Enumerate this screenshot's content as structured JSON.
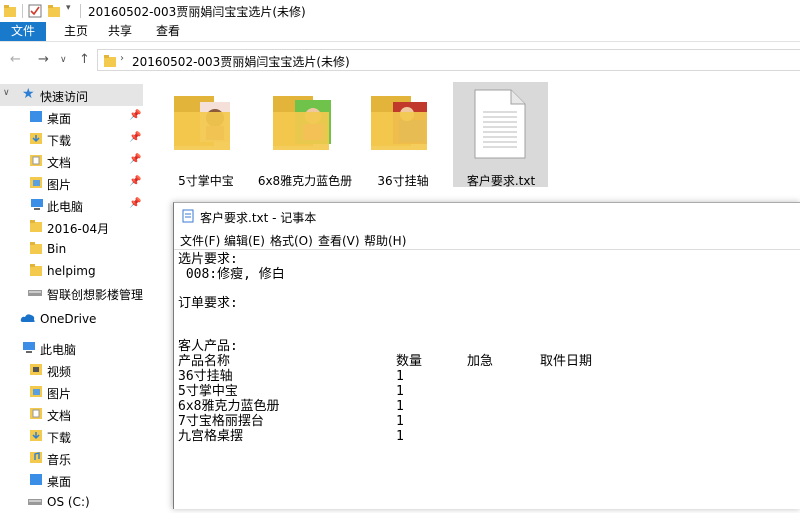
{
  "window": {
    "title": "20160502-003贾丽娟闫宝宝选片(未修)"
  },
  "ribbon": {
    "tabs": [
      "文件",
      "主页",
      "共享",
      "查看"
    ]
  },
  "address": {
    "path": "20160502-003贾丽娟闫宝宝选片(未修)"
  },
  "sidebar": {
    "quick_access": "快速访问",
    "items": [
      {
        "label": "桌面",
        "icon": "desktop-folder-icon",
        "pinned": true
      },
      {
        "label": "下载",
        "icon": "download-folder-icon",
        "pinned": true
      },
      {
        "label": "文档",
        "icon": "documents-folder-icon",
        "pinned": true
      },
      {
        "label": "图片",
        "icon": "pictures-folder-icon",
        "pinned": true
      },
      {
        "label": "此电脑",
        "icon": "computer-icon",
        "pinned": true
      },
      {
        "label": "2016-04月",
        "icon": "folder-icon",
        "pinned": false
      },
      {
        "label": "Bin",
        "icon": "folder-icon",
        "pinned": false
      },
      {
        "label": "helpimg",
        "icon": "folder-icon",
        "pinned": false
      },
      {
        "label": "智联创想影楼管理软",
        "icon": "drive-icon",
        "pinned": false
      }
    ],
    "onedrive": "OneDrive",
    "this_pc": "此电脑",
    "pc_items": [
      {
        "label": "视频",
        "icon": "videos-folder-icon"
      },
      {
        "label": "图片",
        "icon": "pictures-folder-icon"
      },
      {
        "label": "文档",
        "icon": "documents-folder-icon"
      },
      {
        "label": "下载",
        "icon": "download-folder-icon"
      },
      {
        "label": "音乐",
        "icon": "music-folder-icon"
      },
      {
        "label": "桌面",
        "icon": "desktop-folder-icon"
      },
      {
        "label": "OS (C:)",
        "icon": "drive-icon"
      }
    ]
  },
  "files": [
    {
      "name": "5寸掌中宝",
      "type": "folder"
    },
    {
      "name": "6x8雅克力蓝色册",
      "type": "folder"
    },
    {
      "name": "36寸挂轴",
      "type": "folder"
    },
    {
      "name": "客户要求.txt",
      "type": "text"
    }
  ],
  "notepad": {
    "title": "客户要求.txt - 记事本",
    "menu": [
      "文件(F)",
      "编辑(E)",
      "格式(O)",
      "查看(V)",
      "帮助(H)"
    ],
    "lines": {
      "l1": "选片要求:",
      "l2": " 008:修瘦, 修白",
      "l3": "订单要求:",
      "l4": "客人产品:"
    },
    "table": {
      "headers": [
        "产品名称",
        "数量",
        "加急",
        "取件日期"
      ],
      "rows": [
        [
          "36寸挂轴",
          "1"
        ],
        [
          "5寸掌中宝",
          "1"
        ],
        [
          "6x8雅克力蓝色册",
          "1"
        ],
        [
          "7寸宝格丽摆台",
          "1"
        ],
        [
          "九宫格桌摆",
          "1"
        ]
      ]
    }
  },
  "colors": {
    "accent": "#1979ca",
    "folder": "#f3c94e",
    "selection": "#d9d9d9"
  }
}
